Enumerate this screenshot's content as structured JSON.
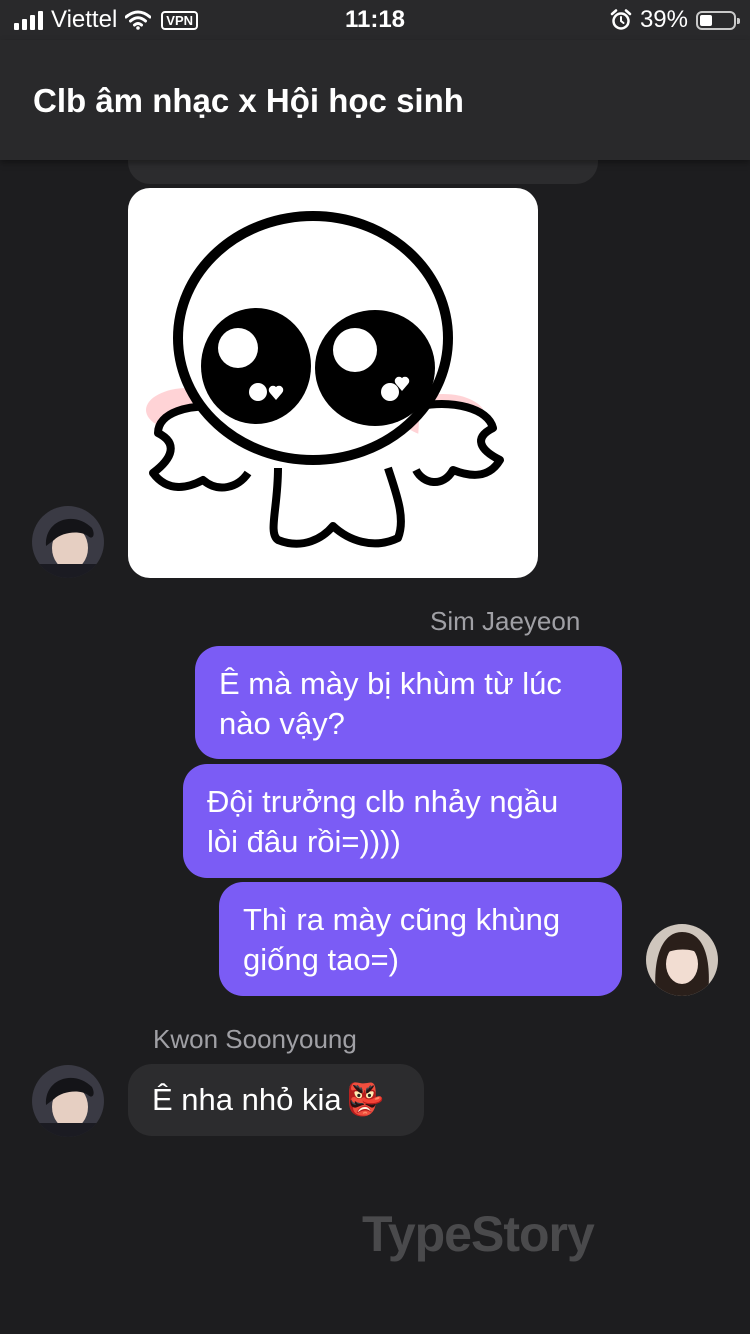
{
  "status_bar": {
    "carrier": "Viettel",
    "vpn": "VPN",
    "time": "11:18",
    "battery": "39%",
    "battery_level": 0.39
  },
  "header": {
    "title": "Clb âm nhạc x Hội học sinh"
  },
  "messages": [
    {
      "type": "sticker",
      "sender": "Kwon Soonyoung",
      "direction": "incoming"
    },
    {
      "type": "sender_label",
      "text": "Sim Jaeyeon"
    },
    {
      "type": "text",
      "direction": "outgoing",
      "text": "Ê mà mày bị khùm từ lúc\nnào vậy?"
    },
    {
      "type": "text",
      "direction": "outgoing",
      "text": "Đội trưởng clb nhảy ngầu\nlòi đâu rồi=))))"
    },
    {
      "type": "text",
      "direction": "outgoing",
      "text": "Thì ra mày cũng khùng\ngiống tao=)"
    },
    {
      "type": "sender_label",
      "text": "Kwon Soonyoung"
    },
    {
      "type": "text",
      "direction": "incoming",
      "text": "Ê nha nhỏ kia",
      "emoji": "👺"
    }
  ],
  "watermark": "TypeStory",
  "icons": {
    "signal": "signal-icon",
    "wifi": "wifi-icon",
    "alarm": "alarm-icon",
    "battery": "battery-icon"
  },
  "colors": {
    "outgoing_bubble": "#7b5cf5",
    "incoming_bubble": "#2c2c2e",
    "background": "#1d1d1f"
  }
}
